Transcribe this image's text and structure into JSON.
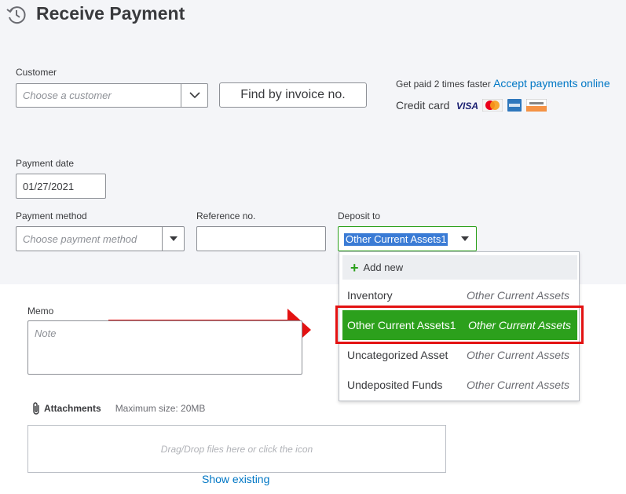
{
  "header": {
    "title": "Receive Payment",
    "icon": "history-icon"
  },
  "customer": {
    "label": "Customer",
    "placeholder": "Choose a customer"
  },
  "find_invoice_button": "Find by invoice no.",
  "promo": {
    "text": "Get paid 2 times faster",
    "link": "Accept payments online",
    "credit_card_label": "Credit card",
    "cards": [
      "VISA",
      "MasterCard",
      "AMERICAN EXPRESS",
      "DISCOVER"
    ]
  },
  "payment_date": {
    "label": "Payment date",
    "value": "01/27/2021"
  },
  "payment_method": {
    "label": "Payment method",
    "placeholder": "Choose payment method"
  },
  "reference": {
    "label": "Reference no.",
    "value": ""
  },
  "deposit_to": {
    "label": "Deposit to",
    "selected": "Other Current Assets1",
    "dropdown": {
      "add_new": "Add new",
      "items": [
        {
          "name": "Inventory",
          "type": "Other Current Assets"
        },
        {
          "name": "Other Current Assets1",
          "type": "Other Current Assets",
          "selected": true
        },
        {
          "name": "Uncategorized Asset",
          "type": "Other Current Assets"
        },
        {
          "name": "Undeposited Funds",
          "type": "Other Current Assets"
        }
      ]
    }
  },
  "memo": {
    "label": "Memo",
    "placeholder": "Note"
  },
  "attachments": {
    "label": "Attachments",
    "max_size": "Maximum size: 20MB",
    "drop_text": "Drag/Drop files here or click the icon",
    "show_existing": "Show existing"
  },
  "colors": {
    "accent_green": "#2ca01c",
    "link_blue": "#0077c5",
    "annotation_red": "#e31212",
    "selection_blue": "#3a7bd5"
  }
}
